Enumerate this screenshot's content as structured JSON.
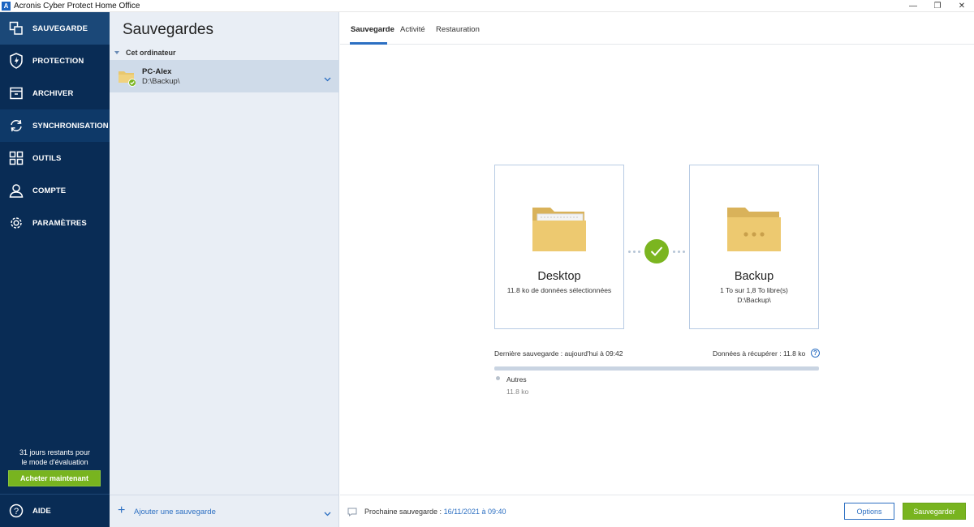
{
  "window": {
    "title": "Acronis Cyber Protect Home Office",
    "logo_letter": "A",
    "controls": {
      "minimize": "—",
      "restore": "❐",
      "close": "✕"
    }
  },
  "nav": {
    "items": [
      {
        "label": "SAUVEGARDE",
        "icon": "backup-icon"
      },
      {
        "label": "PROTECTION",
        "icon": "shield-icon"
      },
      {
        "label": "ARCHIVER",
        "icon": "archive-icon"
      },
      {
        "label": "SYNCHRONISATION",
        "icon": "sync-icon"
      },
      {
        "label": "OUTILS",
        "icon": "tools-grid-icon"
      },
      {
        "label": "COMPTE",
        "icon": "account-icon"
      },
      {
        "label": "PARAMÈTRES",
        "icon": "gear-icon"
      }
    ],
    "trial_line1": "31 jours restants pour",
    "trial_line2": "le mode d'évaluation",
    "buy_label": "Acheter maintenant",
    "help_label": "AIDE"
  },
  "backups_panel": {
    "title": "Sauvegardes",
    "group_label": "Cet ordinateur",
    "item": {
      "name": "PC-Alex",
      "path": "D:\\Backup\\"
    },
    "add_label": "Ajouter une sauvegarde"
  },
  "tabs": [
    "Sauvegarde",
    "Activité",
    "Restauration"
  ],
  "source": {
    "title": "Desktop",
    "subtitle": "11.8 ko de données sélectionnées"
  },
  "destination": {
    "title": "Backup",
    "line1": "1 To sur 1,8 To libre(s)",
    "line2": "D:\\Backup\\"
  },
  "status": {
    "last_backup": "Dernière sauvegarde : aujourd'hui à 09:42",
    "recoverable": "Données à récupérer : 11.8 ko",
    "help_glyph": "?",
    "bar_fraction": 1.0,
    "legend_label": "Autres",
    "legend_value": "11.8 ko"
  },
  "footer": {
    "next_prefix": "Prochaine sauvegarde : ",
    "next_date": "16/11/2021 à 09:40",
    "options_label": "Options",
    "save_label": "Sauvegarder"
  },
  "colors": {
    "nav_bg": "#092c55",
    "accent": "#2c6fc2",
    "green": "#78b41f",
    "folder": "#e8c76d"
  }
}
